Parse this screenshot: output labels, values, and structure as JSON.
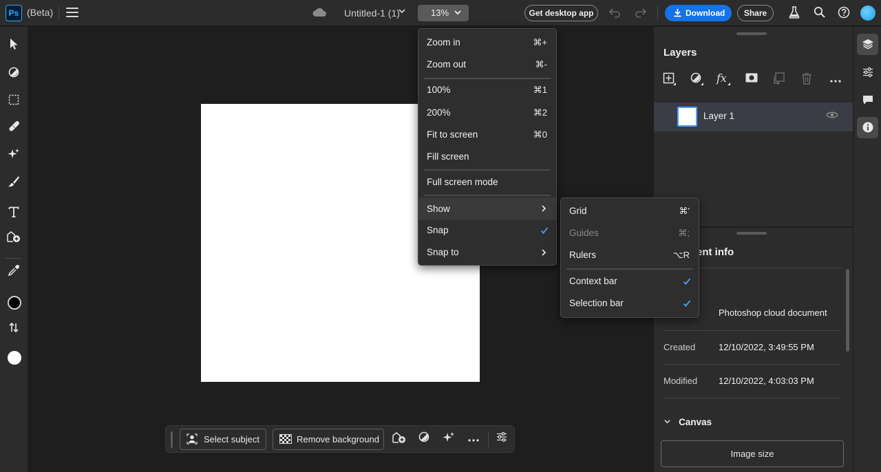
{
  "topbar": {
    "logo": "Ps",
    "beta_label": "(Beta)",
    "doc_title": "Untitled-1 (1)",
    "zoom_level": "13%",
    "get_desktop_label": "Get desktop app",
    "download_label": "Download",
    "share_label": "Share"
  },
  "view_menu": {
    "items": [
      {
        "label": "Zoom in",
        "shortcut": "⌘+"
      },
      {
        "label": "Zoom out",
        "shortcut": "⌘-"
      },
      {
        "label": "100%",
        "shortcut": "⌘1"
      },
      {
        "label": "200%",
        "shortcut": "⌘2"
      },
      {
        "label": "Fit to screen",
        "shortcut": "⌘0"
      },
      {
        "label": "Fill screen",
        "shortcut": ""
      },
      {
        "label": "Full screen mode",
        "shortcut": ""
      },
      {
        "label": "Show",
        "shortcut": ""
      },
      {
        "label": "Snap",
        "shortcut": ""
      },
      {
        "label": "Snap to",
        "shortcut": ""
      }
    ]
  },
  "show_menu": {
    "items": [
      {
        "label": "Grid",
        "shortcut": "⌘'"
      },
      {
        "label": "Guides",
        "shortcut": "⌘;"
      },
      {
        "label": "Rulers",
        "shortcut": "⌥R"
      },
      {
        "label": "Context bar",
        "shortcut": ""
      },
      {
        "label": "Selection bar",
        "shortcut": ""
      }
    ]
  },
  "context_bar": {
    "select_subject_label": "Select subject",
    "remove_background_label": "Remove background"
  },
  "layers_panel": {
    "title": "Layers",
    "layers": [
      {
        "name": "Layer 1"
      }
    ]
  },
  "document_info": {
    "title_visible": "ent info",
    "type_value": "Photoshop cloud document",
    "created_label": "Created",
    "created_value": "12/10/2022, 3:49:55 PM",
    "modified_label": "Modified",
    "modified_value": "12/10/2022, 4:03:03 PM",
    "canvas_section": "Canvas",
    "image_size_label": "Image size"
  },
  "colors": {
    "accent": "#1473e6",
    "check": "#4ba3ff",
    "foreground_swatch": "#000000",
    "background_swatch": "#ffffff"
  }
}
